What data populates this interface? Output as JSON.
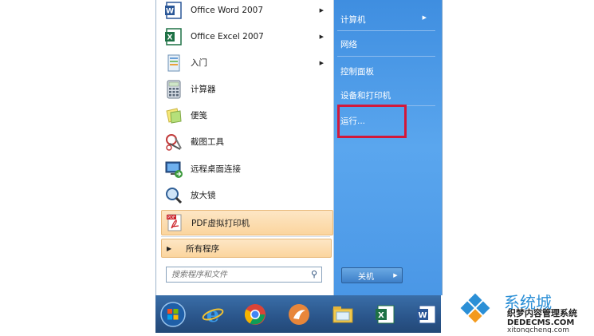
{
  "programs": [
    {
      "label": "Office Word 2007",
      "icon": "word-icon",
      "has_arrow": true
    },
    {
      "label": "Office Excel 2007",
      "icon": "excel-icon",
      "has_arrow": true
    },
    {
      "label": "入门",
      "icon": "getting-started-icon",
      "has_arrow": true
    },
    {
      "label": "计算器",
      "icon": "calculator-icon",
      "has_arrow": false
    },
    {
      "label": "便笺",
      "icon": "sticky-notes-icon",
      "has_arrow": false
    },
    {
      "label": "截图工具",
      "icon": "snipping-tool-icon",
      "has_arrow": false
    },
    {
      "label": "远程桌面连接",
      "icon": "remote-desktop-icon",
      "has_arrow": false
    },
    {
      "label": "放大镜",
      "icon": "magnifier-icon",
      "has_arrow": false
    },
    {
      "label": "PDF虚拟打印机",
      "icon": "pdf-printer-icon",
      "has_arrow": false
    }
  ],
  "all_programs": {
    "label": "所有程序"
  },
  "search": {
    "placeholder": "搜索程序和文件"
  },
  "right_items": {
    "computer": "计算机",
    "network": "网络",
    "control_panel": "控制面板",
    "devices_printers": "设备和打印机",
    "run": "运行..."
  },
  "shutdown": {
    "label": "关机"
  },
  "taskbar": [
    "start-orb-icon",
    "internet-explorer-icon",
    "chrome-icon",
    "app-icon",
    "file-explorer-icon",
    "excel-icon",
    "word-icon"
  ],
  "watermark": {
    "brand": "系统城",
    "line1": "织梦内容管理系统",
    "line2": "DEDECMS.COM",
    "line3": "xitongcheng.com"
  },
  "colors": {
    "highlight_box": "#d2183a",
    "right_pane": "#4a97e6"
  }
}
